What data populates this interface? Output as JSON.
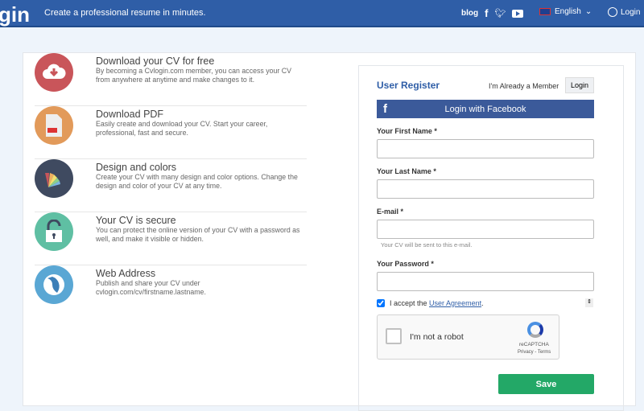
{
  "header": {
    "logo": "gin",
    "tagline": "Create a professional resume in minutes.",
    "blog": "blog",
    "language": "English",
    "login": "Login"
  },
  "features": [
    {
      "title": "Download your CV for free",
      "desc": "By becoming a Cvlogin.com member, you can access your CV from anywhere at anytime and make changes to it.",
      "color": "#c9555a",
      "icon": "cloud-download-icon"
    },
    {
      "title": "Download PDF",
      "desc": "Easily create and download your CV. Start your career, professional, fast and secure.",
      "color": "#e29a5a",
      "icon": "pdf-file-icon"
    },
    {
      "title": "Design and colors",
      "desc": "Create your CV with many design and color options. Change the design and color of your CV at any time.",
      "color": "#3f4a60",
      "icon": "color-palette-icon"
    },
    {
      "title": "Your CV is secure",
      "desc": "You can protect the online version of your CV with a password as well, and make it visible or hidden.",
      "color": "#5fbfa3",
      "icon": "lock-icon"
    },
    {
      "title": "Web Address",
      "desc": "Publish and share your CV under cvlogin.com/cv/firstname.lastname.",
      "color": "#5aa7d4",
      "icon": "globe-icon"
    }
  ],
  "form": {
    "title": "User Register",
    "already": "I'm Already a Member",
    "login": "Login",
    "facebook": "Login with Facebook",
    "first_name": "Your First Name *",
    "last_name": "Your Last Name *",
    "email": "E-mail *",
    "email_hint": "Your CV will be sent to this e-mail.",
    "password": "Your Password *",
    "accept": "I accept the",
    "agreement": "User Agreement",
    "captcha": "I'm not a robot",
    "recaptcha": "reCAPTCHA",
    "recaptcha_links": "Privacy - Terms",
    "save": "Save"
  }
}
